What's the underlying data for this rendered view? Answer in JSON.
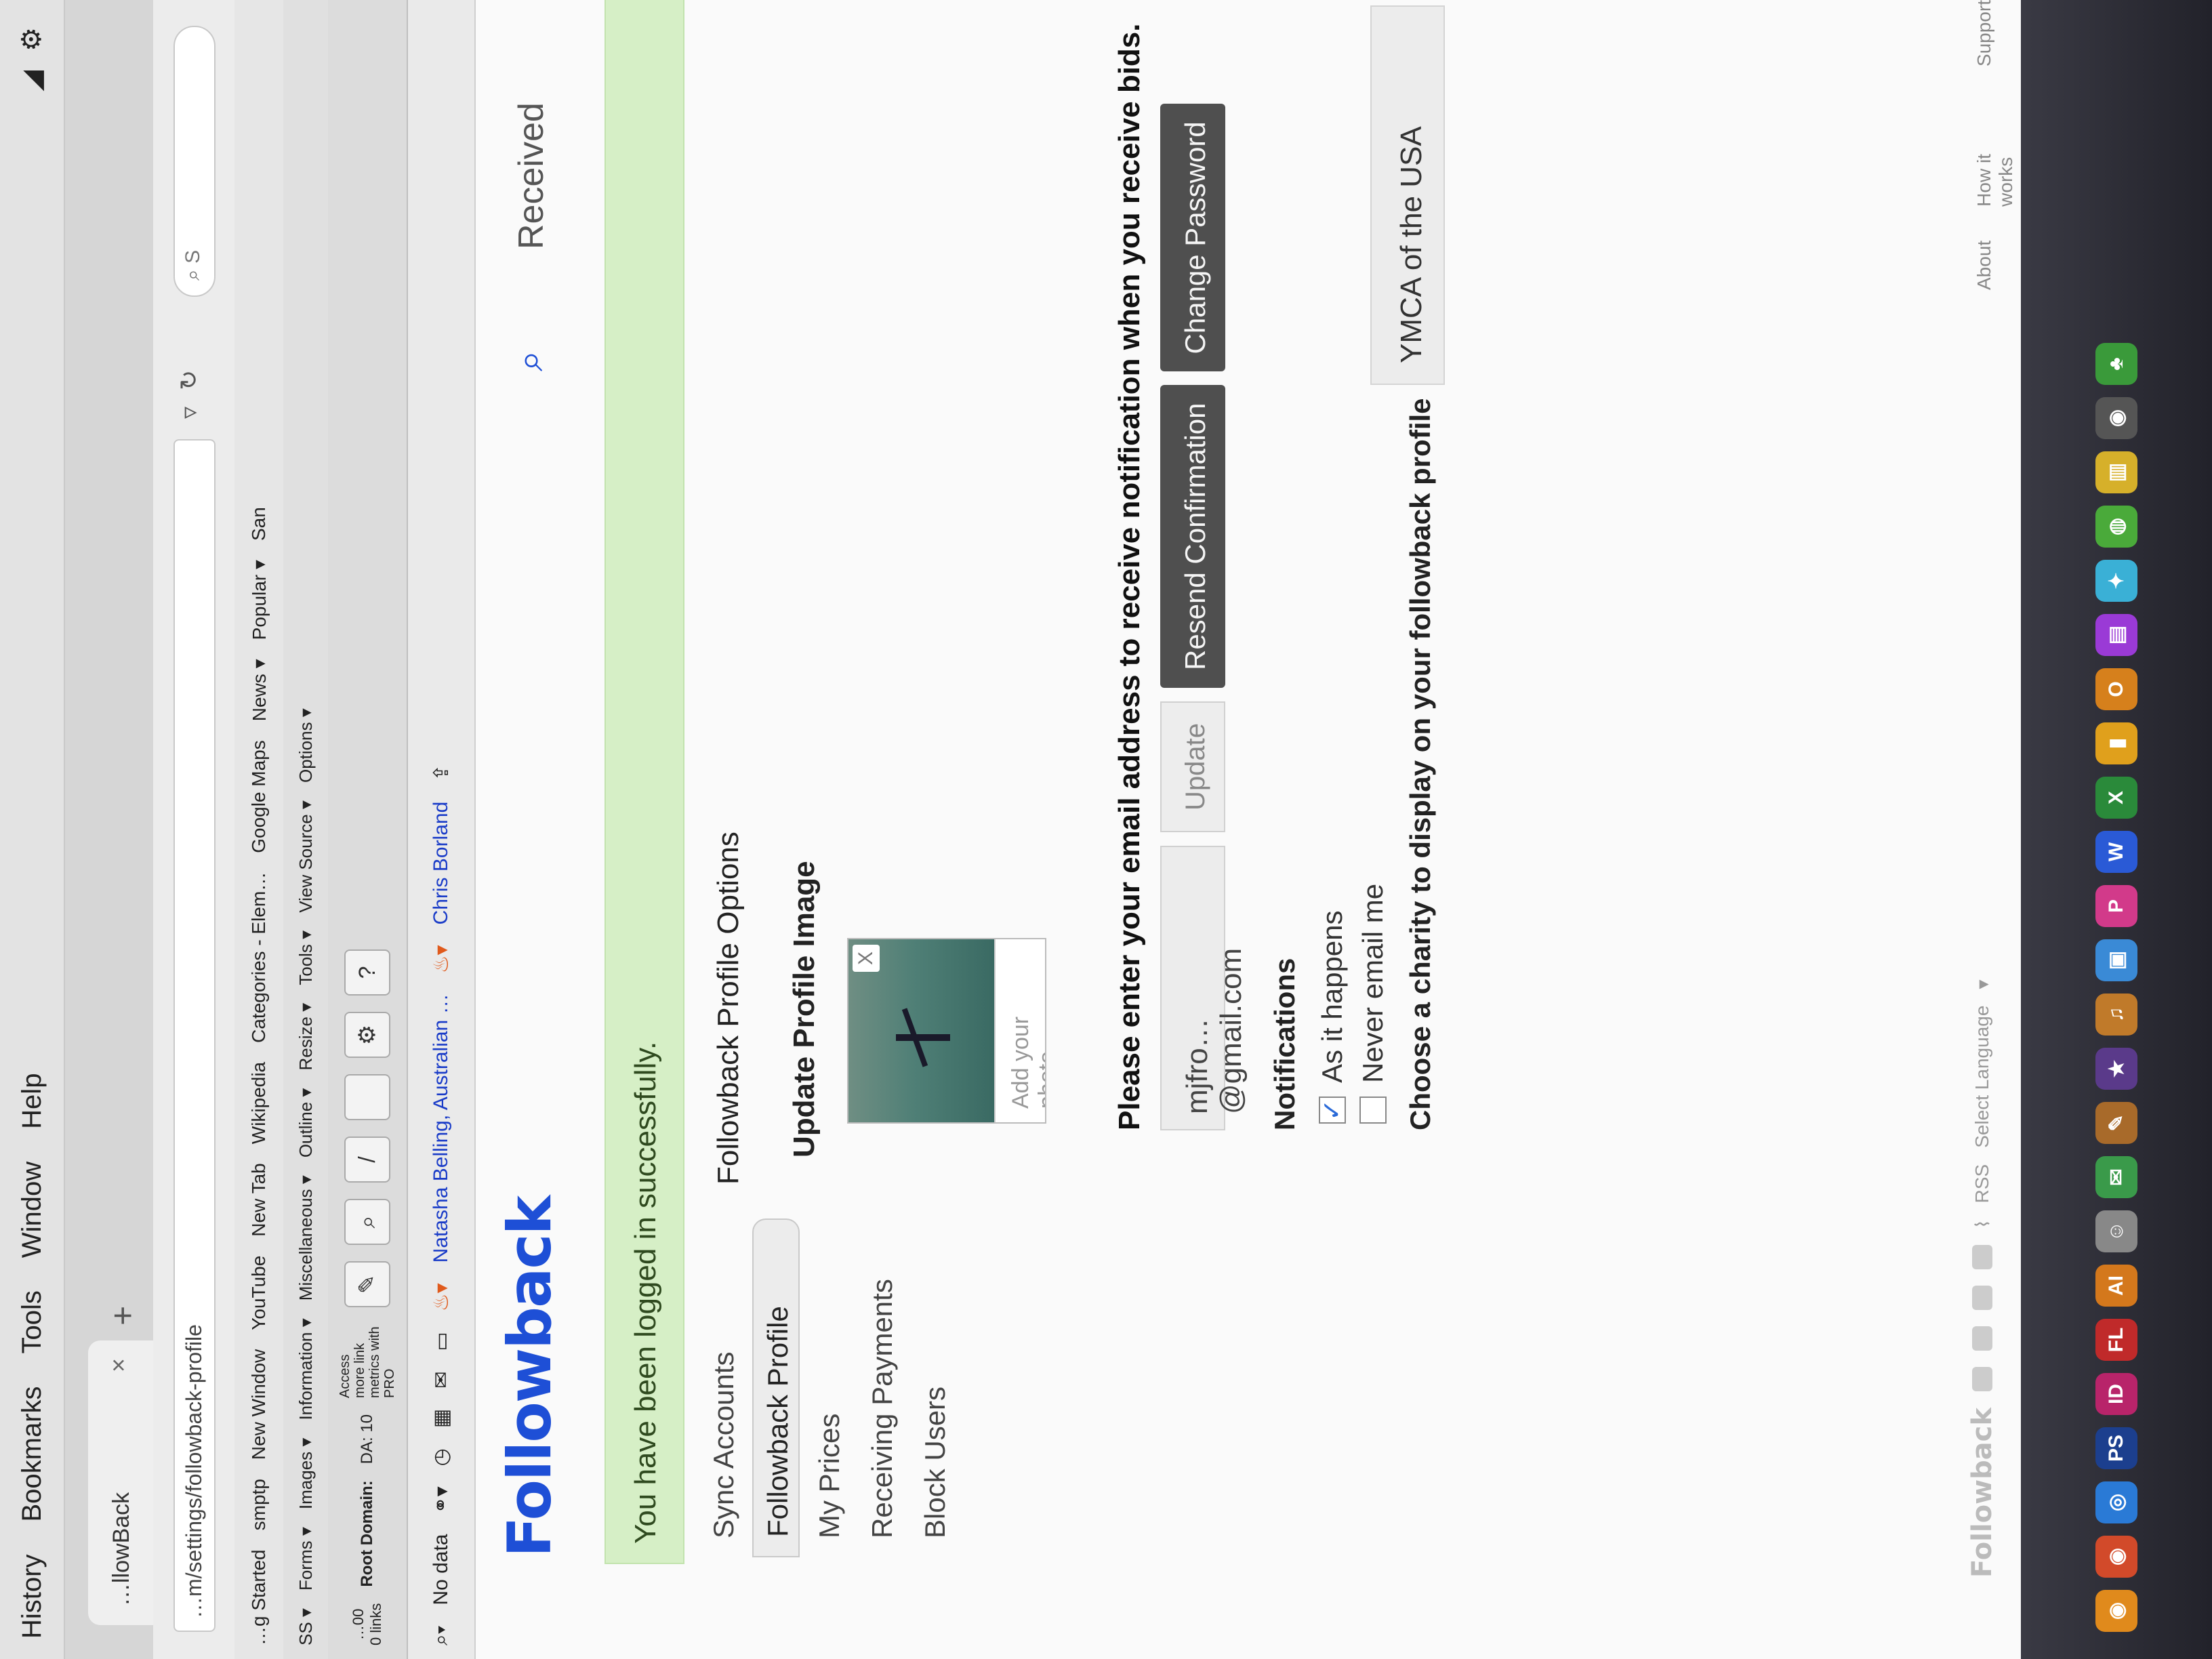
{
  "menubar": {
    "items": [
      "History",
      "Bookmarks",
      "Tools",
      "Window",
      "Help"
    ],
    "right_icons": [
      "wifi-icon",
      "gear-icon"
    ]
  },
  "tab": {
    "title": "…llowBack",
    "close": "×",
    "new_tab": "+"
  },
  "address": {
    "url": "…m/settings/followback-profile",
    "search_placeholder": "S"
  },
  "bookmarks": [
    "…g Started",
    "smptp",
    "New Window",
    "YouTube",
    "New Tab",
    "Wikipedia",
    "Categories - Elem…",
    "Google Maps",
    "News ▾",
    "Popular ▾",
    "San"
  ],
  "webdev": [
    "SS ▾",
    "Forms ▾",
    "Images ▾",
    "Information ▾",
    "Miscellaneous ▾",
    "Outline ▾",
    "Resize ▾",
    "Tools ▾",
    "View Source ▾",
    "Options ▾"
  ],
  "seobar": {
    "left_value": "…00",
    "links": "0 links",
    "root_domain": "Root Domain:",
    "da": "DA: 10",
    "pro_text": "Access more link metrics with PRO"
  },
  "toolbar2": {
    "no_data": "No data",
    "link_text": "Natasha Belling, Australian …",
    "user": "Chris Borland"
  },
  "site": {
    "logo": "Followback",
    "received": "Received"
  },
  "alert": {
    "text": "You have been logged in successfully."
  },
  "sidebar": [
    {
      "label": "Sync Accounts",
      "active": false
    },
    {
      "label": "Followback Profile",
      "active": true
    },
    {
      "label": "My Prices",
      "active": false
    },
    {
      "label": "Receiving Payments",
      "active": false
    },
    {
      "label": "Block Users",
      "active": false
    }
  ],
  "profile": {
    "section_title": "Followback Profile Options",
    "image_label": "Update Profile Image",
    "photo_close": "X",
    "add_photo": "Add your photo",
    "email_prompt": "Please enter your email address to receive notification when you receive bids.",
    "email_value": "mjfro…@gmail.com",
    "update_button": "Update",
    "resend_button": "Resend Confirmation",
    "change_password_button": "Change Password",
    "notifications_title": "Notifications",
    "option_as_it_happens": "As it happens",
    "option_never": "Never email me",
    "as_it_happens_checked": true,
    "charity_label": "Choose a charity to display on your followback profile",
    "charity_value": "YMCA of the USA"
  },
  "footer": {
    "logo": "Followback",
    "rss": "RSS",
    "select_language": "Select Language",
    "links": [
      "About",
      "How it works",
      "Support"
    ]
  },
  "dock": {
    "icons": [
      "PS",
      "ID",
      "FL",
      "AI",
      "P",
      "W",
      "X"
    ]
  },
  "colors": {
    "brand": "#1e4fd6",
    "alert_bg": "#d6efc6",
    "dark_button": "#4f4f4f"
  }
}
